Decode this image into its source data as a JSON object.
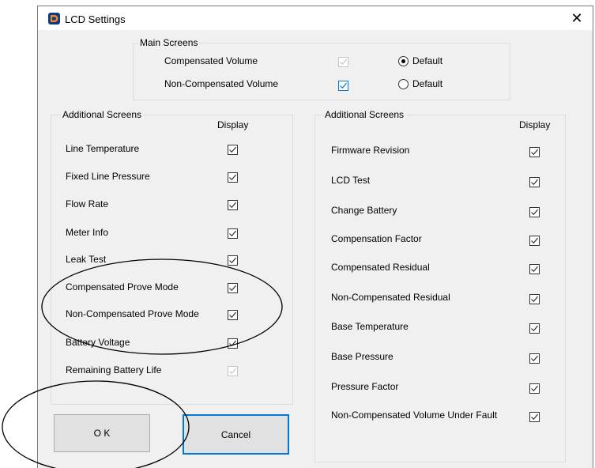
{
  "window": {
    "title": "LCD Settings",
    "close_glyph": "✕",
    "app_icon": "app-logo-icon"
  },
  "main_screens": {
    "legend": "Main Screens",
    "items": [
      {
        "label": "Compensated Volume",
        "checked": true,
        "enabled": false,
        "radio_label": "Default",
        "radio_selected": true
      },
      {
        "label": "Non-Compensated Volume",
        "checked": true,
        "enabled": true,
        "radio_label": "Default",
        "radio_selected": false
      }
    ]
  },
  "left_group": {
    "legend": "Additional Screens",
    "display_header": "Display",
    "items": [
      {
        "label": "Line Temperature",
        "checked": true,
        "enabled": true
      },
      {
        "label": "Fixed Line Pressure",
        "checked": true,
        "enabled": true
      },
      {
        "label": "Flow Rate",
        "checked": true,
        "enabled": true
      },
      {
        "label": "Meter Info",
        "checked": true,
        "enabled": true
      },
      {
        "label": "Leak Test",
        "checked": true,
        "enabled": true
      },
      {
        "label": "Compensated Prove Mode",
        "checked": true,
        "enabled": true
      },
      {
        "label": "Non-Compensated Prove Mode",
        "checked": true,
        "enabled": true
      },
      {
        "label": "Battery Voltage",
        "checked": true,
        "enabled": true
      },
      {
        "label": "Remaining Battery Life",
        "checked": true,
        "enabled": false
      }
    ]
  },
  "right_group": {
    "legend": "Additional Screens",
    "display_header": "Display",
    "items": [
      {
        "label": "Firmware Revision",
        "checked": true
      },
      {
        "label": "LCD Test",
        "checked": true
      },
      {
        "label": "Change Battery",
        "checked": true
      },
      {
        "label": "Compensation Factor",
        "checked": true
      },
      {
        "label": "Compensated Residual",
        "checked": true
      },
      {
        "label": "Non-Compensated Residual",
        "checked": true
      },
      {
        "label": "Base Temperature",
        "checked": true
      },
      {
        "label": "Base Pressure",
        "checked": true
      },
      {
        "label": " Pressure Factor",
        "checked": true
      },
      {
        "label": "Non-Compensated Volume Under Fault",
        "checked": true
      }
    ]
  },
  "buttons": {
    "ok": "O K",
    "cancel": "Cancel"
  },
  "colors": {
    "accent": "#0078d7",
    "dialog_bg": "#f0f0f0",
    "disabled": "#c5c5c5"
  }
}
